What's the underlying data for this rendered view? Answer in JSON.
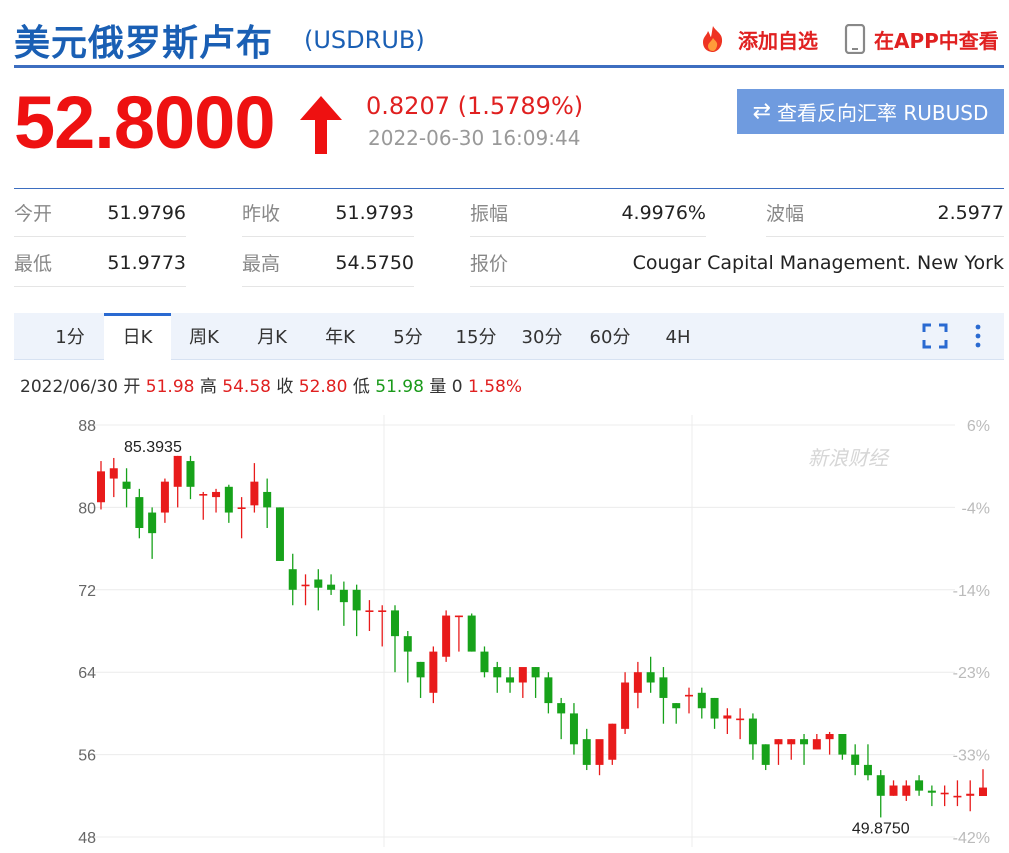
{
  "header": {
    "title": "美元俄罗斯卢布",
    "code": "(USDRUB)",
    "add_fav": "添加自选",
    "view_app": "在APP中查看"
  },
  "quote": {
    "price": "52.8000",
    "change": "0.8207 (1.5789%)",
    "time": "2022-06-30 16:09:44",
    "reverse_label": "查看反向汇率 RUBUSD",
    "direction": "up"
  },
  "stats": [
    {
      "label": "今开",
      "value": "51.9796"
    },
    {
      "label": "昨收",
      "value": "51.9793"
    },
    {
      "label": "振幅",
      "value": "4.9976%"
    },
    {
      "label": "波幅",
      "value": "2.5977"
    },
    {
      "label": "最低",
      "value": "51.9773"
    },
    {
      "label": "最高",
      "value": "54.5750"
    },
    {
      "label": "报价",
      "value": "Cougar Capital Management. New York"
    }
  ],
  "tabs": [
    "1分",
    "日K",
    "周K",
    "月K",
    "年K",
    "5分",
    "15分",
    "30分",
    "60分",
    "4H"
  ],
  "active_tab": "日K",
  "ohlc_bar": {
    "date": "2022/06/30",
    "open_label": "开",
    "open": "51.98",
    "high_label": "高",
    "high": "54.58",
    "close_label": "收",
    "close": "52.80",
    "low_label": "低",
    "low": "51.98",
    "vol_label": "量",
    "vol": "0",
    "pct": "1.58%"
  },
  "colors": {
    "up": "#e81b1b",
    "down": "#17a21a",
    "accent": "#2a6ad1",
    "price": "#ee1111"
  },
  "watermark": "新浪财经",
  "chart_data": {
    "type": "candlestick",
    "y_left_ticks": [
      88,
      80,
      72,
      64,
      56,
      48
    ],
    "y_right_ticks": [
      "6%",
      "-4%",
      "-14%",
      "-23%",
      "-33%",
      "-42%"
    ],
    "ylim": [
      48,
      88
    ],
    "max_label": "85.3935",
    "min_label": "49.8750",
    "candles": [
      {
        "o": 80.5,
        "h": 84.5,
        "l": 79.8,
        "c": 83.5
      },
      {
        "o": 82.8,
        "h": 84.8,
        "l": 81.0,
        "c": 83.8
      },
      {
        "o": 82.5,
        "h": 83.8,
        "l": 80.0,
        "c": 81.8
      },
      {
        "o": 81.0,
        "h": 81.8,
        "l": 77.0,
        "c": 78.0
      },
      {
        "o": 79.5,
        "h": 80.0,
        "l": 75.0,
        "c": 77.5
      },
      {
        "o": 79.5,
        "h": 82.8,
        "l": 78.5,
        "c": 82.5
      },
      {
        "o": 82.0,
        "h": 85.0,
        "l": 80.0,
        "c": 85.0
      },
      {
        "o": 84.5,
        "h": 85.0,
        "l": 80.8,
        "c": 82.0
      },
      {
        "o": 81.3,
        "h": 81.5,
        "l": 78.8,
        "c": 81.3
      },
      {
        "o": 81.0,
        "h": 81.8,
        "l": 79.5,
        "c": 81.5
      },
      {
        "o": 82.0,
        "h": 82.2,
        "l": 78.5,
        "c": 79.5
      },
      {
        "o": 80.0,
        "h": 81.0,
        "l": 77.0,
        "c": 80.0
      },
      {
        "o": 80.2,
        "h": 84.3,
        "l": 79.5,
        "c": 82.5
      },
      {
        "o": 81.5,
        "h": 82.8,
        "l": 78.0,
        "c": 80.0
      },
      {
        "o": 80.0,
        "h": 80.0,
        "l": 74.8,
        "c": 74.8
      },
      {
        "o": 74.0,
        "h": 75.5,
        "l": 70.5,
        "c": 72.0
      },
      {
        "o": 72.5,
        "h": 73.5,
        "l": 70.5,
        "c": 72.5
      },
      {
        "o": 73.0,
        "h": 74.0,
        "l": 70.0,
        "c": 72.2
      },
      {
        "o": 72.5,
        "h": 73.5,
        "l": 71.5,
        "c": 72.0
      },
      {
        "o": 72.0,
        "h": 72.8,
        "l": 68.5,
        "c": 70.8
      },
      {
        "o": 72.0,
        "h": 72.5,
        "l": 67.5,
        "c": 70.0
      },
      {
        "o": 70.0,
        "h": 71.0,
        "l": 68.0,
        "c": 70.0
      },
      {
        "o": 70.0,
        "h": 70.5,
        "l": 66.5,
        "c": 70.0
      },
      {
        "o": 70.0,
        "h": 70.5,
        "l": 64.0,
        "c": 67.5
      },
      {
        "o": 67.5,
        "h": 68.0,
        "l": 63.0,
        "c": 66.0
      },
      {
        "o": 65.0,
        "h": 65.0,
        "l": 61.5,
        "c": 63.5
      },
      {
        "o": 62.0,
        "h": 66.5,
        "l": 61.0,
        "c": 66.0
      },
      {
        "o": 65.5,
        "h": 70.0,
        "l": 65.0,
        "c": 69.5
      },
      {
        "o": 69.5,
        "h": 69.5,
        "l": 66.0,
        "c": 69.5
      },
      {
        "o": 69.5,
        "h": 69.7,
        "l": 66.0,
        "c": 66.0
      },
      {
        "o": 66.0,
        "h": 66.5,
        "l": 63.5,
        "c": 64.0
      },
      {
        "o": 64.5,
        "h": 65.0,
        "l": 62.0,
        "c": 63.5
      },
      {
        "o": 63.5,
        "h": 64.5,
        "l": 62.0,
        "c": 63.0
      },
      {
        "o": 63.0,
        "h": 64.0,
        "l": 61.5,
        "c": 64.5
      },
      {
        "o": 64.5,
        "h": 64.5,
        "l": 61.5,
        "c": 63.5
      },
      {
        "o": 63.5,
        "h": 64.0,
        "l": 60.0,
        "c": 61.0
      },
      {
        "o": 61.0,
        "h": 61.5,
        "l": 57.5,
        "c": 60.0
      },
      {
        "o": 60.0,
        "h": 61.0,
        "l": 56.0,
        "c": 57.0
      },
      {
        "o": 57.5,
        "h": 58.5,
        "l": 54.5,
        "c": 55.0
      },
      {
        "o": 55.0,
        "h": 57.0,
        "l": 54.0,
        "c": 57.5
      },
      {
        "o": 55.5,
        "h": 59.0,
        "l": 55.0,
        "c": 59.0
      },
      {
        "o": 58.5,
        "h": 64.0,
        "l": 58.0,
        "c": 63.0
      },
      {
        "o": 62.0,
        "h": 65.0,
        "l": 60.5,
        "c": 64.0
      },
      {
        "o": 64.0,
        "h": 65.5,
        "l": 62.0,
        "c": 63.0
      },
      {
        "o": 63.5,
        "h": 64.5,
        "l": 59.0,
        "c": 61.5
      },
      {
        "o": 61.0,
        "h": 61.0,
        "l": 59.0,
        "c": 60.5
      },
      {
        "o": 61.8,
        "h": 62.5,
        "l": 60.0,
        "c": 61.8
      },
      {
        "o": 62.0,
        "h": 62.5,
        "l": 59.5,
        "c": 60.5
      },
      {
        "o": 61.5,
        "h": 61.5,
        "l": 58.5,
        "c": 59.5
      },
      {
        "o": 59.5,
        "h": 60.5,
        "l": 58.0,
        "c": 59.8
      },
      {
        "o": 59.5,
        "h": 60.5,
        "l": 57.5,
        "c": 59.5
      },
      {
        "o": 59.5,
        "h": 60.0,
        "l": 55.5,
        "c": 57.0
      },
      {
        "o": 57.0,
        "h": 57.0,
        "l": 54.5,
        "c": 55.0
      },
      {
        "o": 57.0,
        "h": 57.5,
        "l": 55.0,
        "c": 57.5
      },
      {
        "o": 57.0,
        "h": 57.5,
        "l": 55.5,
        "c": 57.5
      },
      {
        "o": 57.5,
        "h": 58.0,
        "l": 55.0,
        "c": 57.0
      },
      {
        "o": 56.5,
        "h": 58.0,
        "l": 56.5,
        "c": 57.5
      },
      {
        "o": 57.5,
        "h": 58.2,
        "l": 56.0,
        "c": 58.0
      },
      {
        "o": 58.0,
        "h": 58.0,
        "l": 55.5,
        "c": 56.0
      },
      {
        "o": 56.0,
        "h": 57.0,
        "l": 54.0,
        "c": 55.0
      },
      {
        "o": 55.0,
        "h": 57.0,
        "l": 53.5,
        "c": 54.0
      },
      {
        "o": 54.0,
        "h": 54.5,
        "l": 49.9,
        "c": 52.0
      },
      {
        "o": 52.0,
        "h": 53.5,
        "l": 52.0,
        "c": 53.0
      },
      {
        "o": 52.0,
        "h": 53.5,
        "l": 51.5,
        "c": 53.0
      },
      {
        "o": 53.5,
        "h": 54.0,
        "l": 52.0,
        "c": 52.5
      },
      {
        "o": 52.5,
        "h": 53.0,
        "l": 51.0,
        "c": 52.3
      },
      {
        "o": 52.3,
        "h": 53.0,
        "l": 51.0,
        "c": 52.3
      },
      {
        "o": 52.0,
        "h": 53.5,
        "l": 51.0,
        "c": 52.0
      },
      {
        "o": 52.0,
        "h": 53.5,
        "l": 50.5,
        "c": 52.2
      },
      {
        "o": 51.98,
        "h": 54.58,
        "l": 51.98,
        "c": 52.8
      }
    ]
  }
}
